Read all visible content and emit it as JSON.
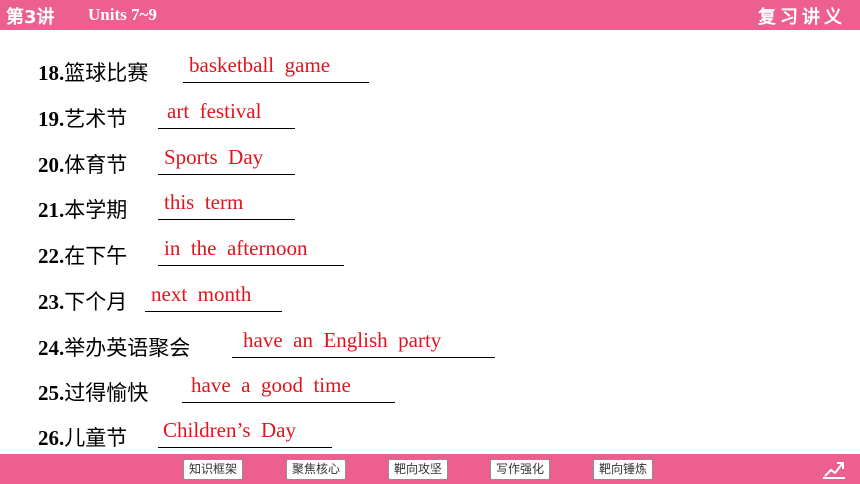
{
  "header": {
    "lesson": "第3讲",
    "units": "Units 7~9",
    "review_title": "复习讲义"
  },
  "items": [
    {
      "num": "18.",
      "zh": "篮球比赛",
      "answer": "basketball  game"
    },
    {
      "num": "19.",
      "zh": "艺术节",
      "answer": "art  festival"
    },
    {
      "num": "20.",
      "zh": "体育节",
      "answer": "Sports  Day"
    },
    {
      "num": "21.",
      "zh": "本学期",
      "answer": "this  term"
    },
    {
      "num": "22.",
      "zh": "在下午",
      "answer": "in  the  afternoon"
    },
    {
      "num": "23.",
      "zh": "下个月",
      "answer": "next  month"
    },
    {
      "num": "24.",
      "zh": "举办英语聚会",
      "answer": "have  an  English  party"
    },
    {
      "num": "25.",
      "zh": "过得愉快",
      "answer": "have  a  good  time"
    },
    {
      "num": "26.",
      "zh": "儿童节",
      "answer": "Children’s  Day"
    }
  ],
  "footer": {
    "nav": [
      "知识框架",
      "聚焦核心",
      "靶向攻坚",
      "写作强化",
      "靶向锤炼"
    ],
    "page_icon": "page-return-icon"
  },
  "colors": {
    "bar": "#ec5f8e",
    "answer": "#e0141d"
  }
}
